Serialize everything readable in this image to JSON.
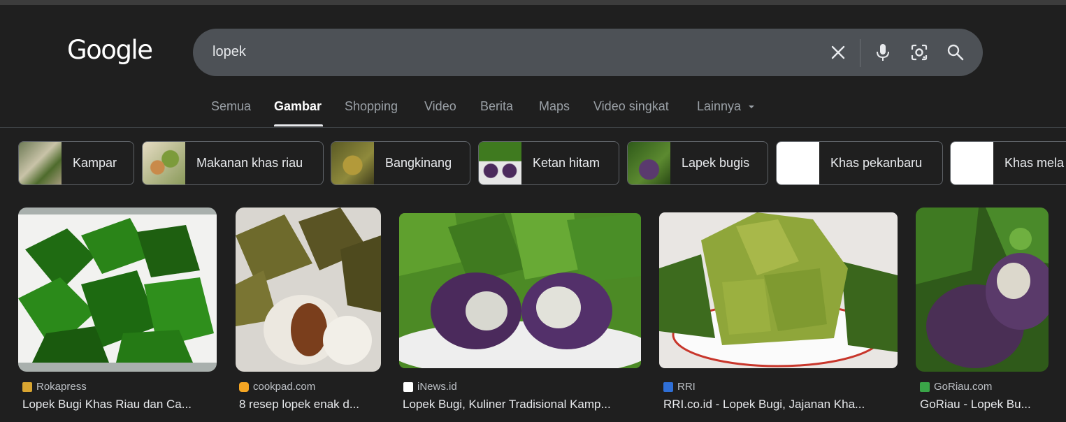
{
  "brand": {
    "logo_text": "Google"
  },
  "search": {
    "query": "lopek"
  },
  "search_icons": {
    "clear": "close-icon",
    "voice": "microphone-icon",
    "lens": "camera-lens-icon",
    "submit": "search-icon"
  },
  "tabs": [
    {
      "label": "Semua",
      "active": false
    },
    {
      "label": "Gambar",
      "active": true
    },
    {
      "label": "Shopping",
      "active": false
    },
    {
      "label": "Video",
      "active": false
    },
    {
      "label": "Berita",
      "active": false
    },
    {
      "label": "Maps",
      "active": false
    },
    {
      "label": "Video singkat",
      "active": false
    },
    {
      "label": "Lainnya",
      "active": false
    }
  ],
  "chips": [
    {
      "label": "Kampar"
    },
    {
      "label": "Makanan khas riau"
    },
    {
      "label": "Bangkinang"
    },
    {
      "label": "Ketan hitam"
    },
    {
      "label": "Lapek bugis"
    },
    {
      "label": "Khas pekanbaru"
    },
    {
      "label": "Khas mela"
    }
  ],
  "results": [
    {
      "source": "Rokapress",
      "title": "Lopek Bugi Khas Riau dan Ca..."
    },
    {
      "source": "cookpad.com",
      "title": "8 resep lopek enak d..."
    },
    {
      "source": "iNews.id",
      "title": "Lopek Bugi, Kuliner Tradisional Kamp..."
    },
    {
      "source": "RRI",
      "title": "RRI.co.id - Lopek Bugi, Jajanan Kha..."
    },
    {
      "source": "GoRiau.com",
      "title": "GoRiau - Lopek Bu..."
    }
  ],
  "colors": {
    "background": "#1f1f1f",
    "searchbar": "#4d5156",
    "text": "#e8eaed",
    "muted": "#9aa0a6",
    "leaf_green": "#3f7a1f",
    "purple": "#4b2a5c"
  }
}
